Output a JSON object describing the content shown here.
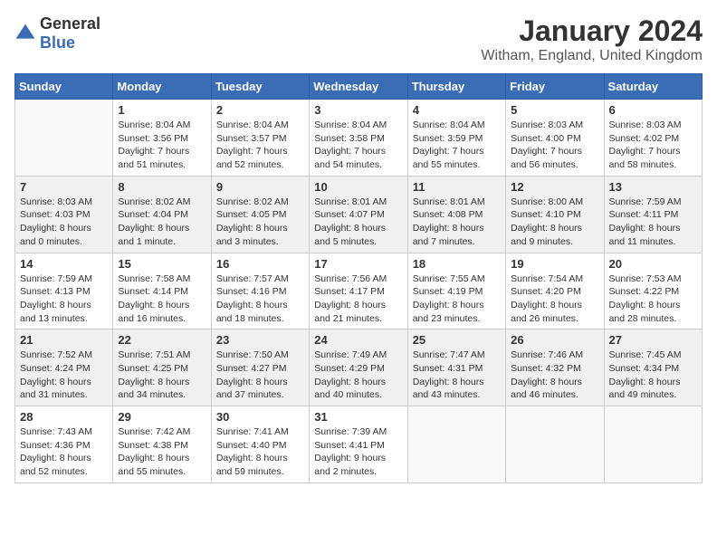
{
  "logo": {
    "general": "General",
    "blue": "Blue"
  },
  "title": "January 2024",
  "location": "Witham, England, United Kingdom",
  "days_of_week": [
    "Sunday",
    "Monday",
    "Tuesday",
    "Wednesday",
    "Thursday",
    "Friday",
    "Saturday"
  ],
  "weeks": [
    [
      {
        "day": "",
        "info": ""
      },
      {
        "day": "1",
        "info": "Sunrise: 8:04 AM\nSunset: 3:56 PM\nDaylight: 7 hours\nand 51 minutes."
      },
      {
        "day": "2",
        "info": "Sunrise: 8:04 AM\nSunset: 3:57 PM\nDaylight: 7 hours\nand 52 minutes."
      },
      {
        "day": "3",
        "info": "Sunrise: 8:04 AM\nSunset: 3:58 PM\nDaylight: 7 hours\nand 54 minutes."
      },
      {
        "day": "4",
        "info": "Sunrise: 8:04 AM\nSunset: 3:59 PM\nDaylight: 7 hours\nand 55 minutes."
      },
      {
        "day": "5",
        "info": "Sunrise: 8:03 AM\nSunset: 4:00 PM\nDaylight: 7 hours\nand 56 minutes."
      },
      {
        "day": "6",
        "info": "Sunrise: 8:03 AM\nSunset: 4:02 PM\nDaylight: 7 hours\nand 58 minutes."
      }
    ],
    [
      {
        "day": "7",
        "info": "Sunrise: 8:03 AM\nSunset: 4:03 PM\nDaylight: 8 hours\nand 0 minutes."
      },
      {
        "day": "8",
        "info": "Sunrise: 8:02 AM\nSunset: 4:04 PM\nDaylight: 8 hours\nand 1 minute."
      },
      {
        "day": "9",
        "info": "Sunrise: 8:02 AM\nSunset: 4:05 PM\nDaylight: 8 hours\nand 3 minutes."
      },
      {
        "day": "10",
        "info": "Sunrise: 8:01 AM\nSunset: 4:07 PM\nDaylight: 8 hours\nand 5 minutes."
      },
      {
        "day": "11",
        "info": "Sunrise: 8:01 AM\nSunset: 4:08 PM\nDaylight: 8 hours\nand 7 minutes."
      },
      {
        "day": "12",
        "info": "Sunrise: 8:00 AM\nSunset: 4:10 PM\nDaylight: 8 hours\nand 9 minutes."
      },
      {
        "day": "13",
        "info": "Sunrise: 7:59 AM\nSunset: 4:11 PM\nDaylight: 8 hours\nand 11 minutes."
      }
    ],
    [
      {
        "day": "14",
        "info": "Sunrise: 7:59 AM\nSunset: 4:13 PM\nDaylight: 8 hours\nand 13 minutes."
      },
      {
        "day": "15",
        "info": "Sunrise: 7:58 AM\nSunset: 4:14 PM\nDaylight: 8 hours\nand 16 minutes."
      },
      {
        "day": "16",
        "info": "Sunrise: 7:57 AM\nSunset: 4:16 PM\nDaylight: 8 hours\nand 18 minutes."
      },
      {
        "day": "17",
        "info": "Sunrise: 7:56 AM\nSunset: 4:17 PM\nDaylight: 8 hours\nand 21 minutes."
      },
      {
        "day": "18",
        "info": "Sunrise: 7:55 AM\nSunset: 4:19 PM\nDaylight: 8 hours\nand 23 minutes."
      },
      {
        "day": "19",
        "info": "Sunrise: 7:54 AM\nSunset: 4:20 PM\nDaylight: 8 hours\nand 26 minutes."
      },
      {
        "day": "20",
        "info": "Sunrise: 7:53 AM\nSunset: 4:22 PM\nDaylight: 8 hours\nand 28 minutes."
      }
    ],
    [
      {
        "day": "21",
        "info": "Sunrise: 7:52 AM\nSunset: 4:24 PM\nDaylight: 8 hours\nand 31 minutes."
      },
      {
        "day": "22",
        "info": "Sunrise: 7:51 AM\nSunset: 4:25 PM\nDaylight: 8 hours\nand 34 minutes."
      },
      {
        "day": "23",
        "info": "Sunrise: 7:50 AM\nSunset: 4:27 PM\nDaylight: 8 hours\nand 37 minutes."
      },
      {
        "day": "24",
        "info": "Sunrise: 7:49 AM\nSunset: 4:29 PM\nDaylight: 8 hours\nand 40 minutes."
      },
      {
        "day": "25",
        "info": "Sunrise: 7:47 AM\nSunset: 4:31 PM\nDaylight: 8 hours\nand 43 minutes."
      },
      {
        "day": "26",
        "info": "Sunrise: 7:46 AM\nSunset: 4:32 PM\nDaylight: 8 hours\nand 46 minutes."
      },
      {
        "day": "27",
        "info": "Sunrise: 7:45 AM\nSunset: 4:34 PM\nDaylight: 8 hours\nand 49 minutes."
      }
    ],
    [
      {
        "day": "28",
        "info": "Sunrise: 7:43 AM\nSunset: 4:36 PM\nDaylight: 8 hours\nand 52 minutes."
      },
      {
        "day": "29",
        "info": "Sunrise: 7:42 AM\nSunset: 4:38 PM\nDaylight: 8 hours\nand 55 minutes."
      },
      {
        "day": "30",
        "info": "Sunrise: 7:41 AM\nSunset: 4:40 PM\nDaylight: 8 hours\nand 59 minutes."
      },
      {
        "day": "31",
        "info": "Sunrise: 7:39 AM\nSunset: 4:41 PM\nDaylight: 9 hours\nand 2 minutes."
      },
      {
        "day": "",
        "info": ""
      },
      {
        "day": "",
        "info": ""
      },
      {
        "day": "",
        "info": ""
      }
    ]
  ]
}
